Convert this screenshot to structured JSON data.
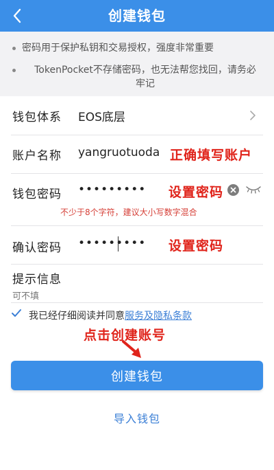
{
  "header": {
    "title": "创建钱包"
  },
  "notice": {
    "line1": "密码用于保护私钥和交易授权，强度非常重要",
    "line2a": "TokenPocket不存储密码，也无法帮您找回，请务必",
    "line2b": "牢记"
  },
  "form": {
    "system": {
      "label": "钱包体系",
      "value": "EOS底层"
    },
    "account": {
      "label": "账户名称",
      "value": "yangruotuoda"
    },
    "password": {
      "label": "钱包密码",
      "value": "•••••••••",
      "hint": "不少于8个字符，建议大小写数字混合"
    },
    "confirm": {
      "label": "确认密码",
      "value": "•••••••••"
    },
    "prompt": {
      "label": "提示信息",
      "placeholder": "可不填"
    }
  },
  "agree": {
    "text": "我已经仔细阅读并同意",
    "link": "服务及隐私条款"
  },
  "annotations": {
    "account": "正确填写账户",
    "password": "设置密码",
    "confirm": "设置密码",
    "create": "点击创建账号"
  },
  "actions": {
    "create": "创建钱包",
    "import": "导入钱包"
  },
  "colors": {
    "brand": "#3b8fe8",
    "annotation": "#e0241b",
    "link": "#3b7fd6"
  }
}
